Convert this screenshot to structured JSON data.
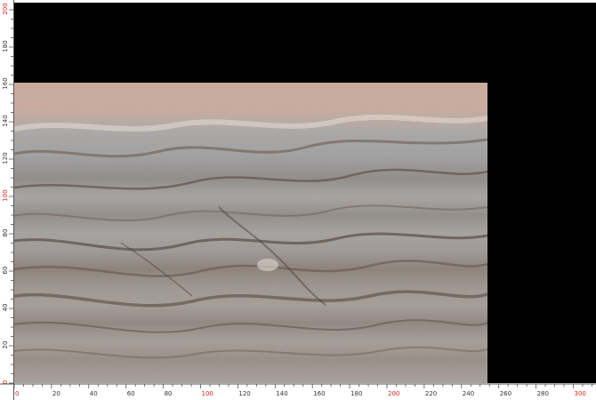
{
  "image": {
    "subject": "marble slab",
    "background_color": "#000000"
  },
  "rulers": {
    "x_unit_ticks": [
      0,
      20,
      40,
      60,
      80,
      100,
      120,
      140,
      160,
      180,
      200,
      220,
      240,
      260,
      280,
      300
    ],
    "y_unit_ticks": [
      0,
      20,
      40,
      60,
      80,
      100,
      120,
      140,
      160,
      180,
      200
    ],
    "highlight_every": 100,
    "highlight_color": "#d42020",
    "normal_color": "#333333"
  },
  "slab": {
    "extent_x": [
      0,
      254
    ],
    "extent_y": [
      0,
      160
    ]
  }
}
